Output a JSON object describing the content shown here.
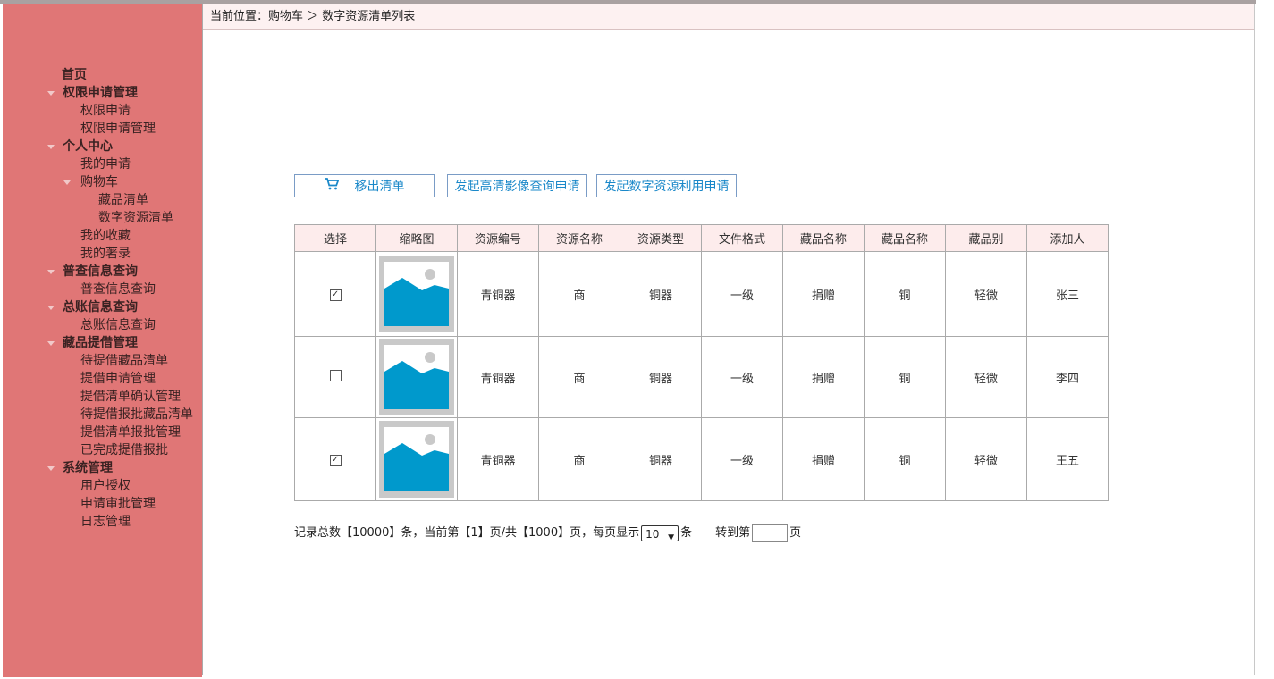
{
  "breadcrumb": "当前位置：购物车 ＞ 数字资源清单列表",
  "sidebar": {
    "items": [
      {
        "label": "首页"
      },
      {
        "label": "权限申请管理"
      },
      {
        "label": "权限申请"
      },
      {
        "label": "权限申请管理"
      },
      {
        "label": "个人中心"
      },
      {
        "label": "我的申请"
      },
      {
        "label": "购物车"
      },
      {
        "label": "藏品清单"
      },
      {
        "label": "数字资源清单"
      },
      {
        "label": "我的收藏"
      },
      {
        "label": "我的著录"
      },
      {
        "label": "普查信息查询"
      },
      {
        "label": "普查信息查询"
      },
      {
        "label": "总账信息查询"
      },
      {
        "label": "总账信息查询"
      },
      {
        "label": "藏品提借管理"
      },
      {
        "label": "待提借藏品清单"
      },
      {
        "label": "提借申请管理"
      },
      {
        "label": "提借清单确认管理"
      },
      {
        "label": "待提借报批藏品清单"
      },
      {
        "label": "提借清单报批管理"
      },
      {
        "label": "已完成提借报批"
      },
      {
        "label": "系统管理"
      },
      {
        "label": "用户授权"
      },
      {
        "label": "申请审批管理"
      },
      {
        "label": "日志管理"
      }
    ]
  },
  "toolbar": {
    "remove_label": "移出清单",
    "hd_query_label": "发起高清影像查询申请",
    "digital_use_label": "发起数字资源利用申请"
  },
  "table": {
    "headers": [
      "选择",
      "缩略图",
      "资源编号",
      "资源名称",
      "资源类型",
      "文件格式",
      "藏品名称",
      "藏品名称",
      "藏品别",
      "添加人"
    ],
    "rows": [
      {
        "checked": true,
        "cells": [
          "青铜器",
          "商",
          "铜器",
          "一级",
          "捐赠",
          "铜",
          "轻微",
          "张三"
        ]
      },
      {
        "checked": false,
        "cells": [
          "青铜器",
          "商",
          "铜器",
          "一级",
          "捐赠",
          "铜",
          "轻微",
          "李四"
        ]
      },
      {
        "checked": true,
        "cells": [
          "青铜器",
          "商",
          "铜器",
          "一级",
          "捐赠",
          "铜",
          "轻微",
          "王五"
        ]
      }
    ]
  },
  "pager": {
    "summary": "记录总数【10000】条，当前第【1】页/共【1000】页，每页显示",
    "page_size": "10",
    "unit": "条",
    "goto_label": "转到第",
    "page_unit": "页"
  },
  "colors": {
    "sidebar": "#e07676",
    "accent": "#1a88c9",
    "thumb_blue": "#0099cc"
  }
}
